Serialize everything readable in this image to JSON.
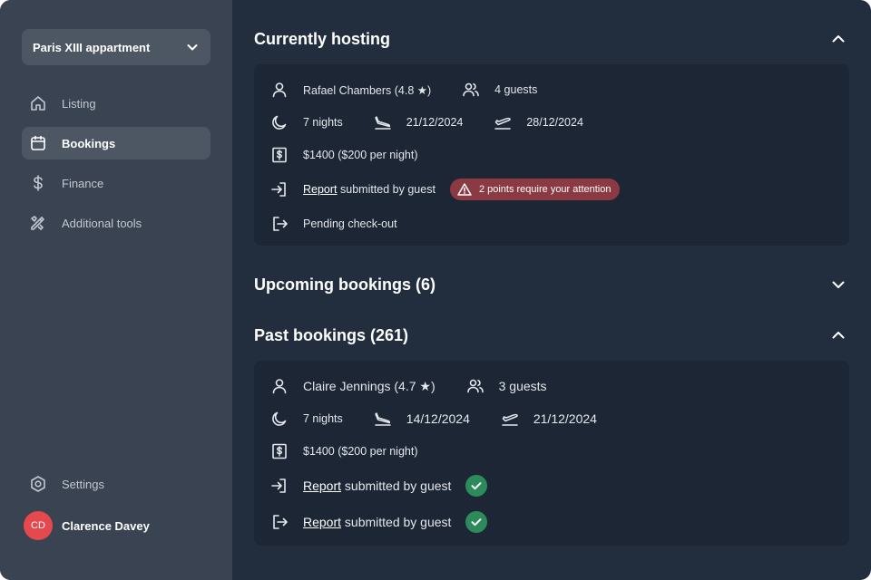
{
  "sidebar": {
    "property": "Paris XIII appartment",
    "nav": [
      {
        "label": "Listing",
        "icon": "home-icon"
      },
      {
        "label": "Bookings",
        "icon": "calendar-icon",
        "active": true
      },
      {
        "label": "Finance",
        "icon": "dollar-icon"
      },
      {
        "label": "Additional tools",
        "icon": "tools-icon"
      }
    ],
    "settings_label": "Settings",
    "user": {
      "initials": "CD",
      "name": "Clarence Davey"
    }
  },
  "current": {
    "title": "Currently hosting",
    "guest": "Rafael Chambers (4.8 ★)",
    "guests": "4 guests",
    "nights": "7 nights",
    "checkin": "21/12/2024",
    "checkout": "28/12/2024",
    "price": "$1400 ($200 per night)",
    "report_link": "Report",
    "report_text": " submitted by guest",
    "attention": "2 points require your attention",
    "status": "Pending check-out"
  },
  "upcoming": {
    "title": "Upcoming bookings (6)"
  },
  "past": {
    "title": "Past bookings (261)",
    "guest": "Claire Jennings (4.7 ★)",
    "guests": "3 guests",
    "nights": "7 nights",
    "checkin": "14/12/2024",
    "checkout": "21/12/2024",
    "price": "$1400 ($200 per night)",
    "report1_link": "Report",
    "report1_text": " submitted by guest",
    "report2_link": "Report",
    "report2_text": " submitted by guest"
  },
  "colors": {
    "accent_alert": "#8b3a43",
    "success": "#2d8a5a",
    "avatar": "#e5484d"
  }
}
